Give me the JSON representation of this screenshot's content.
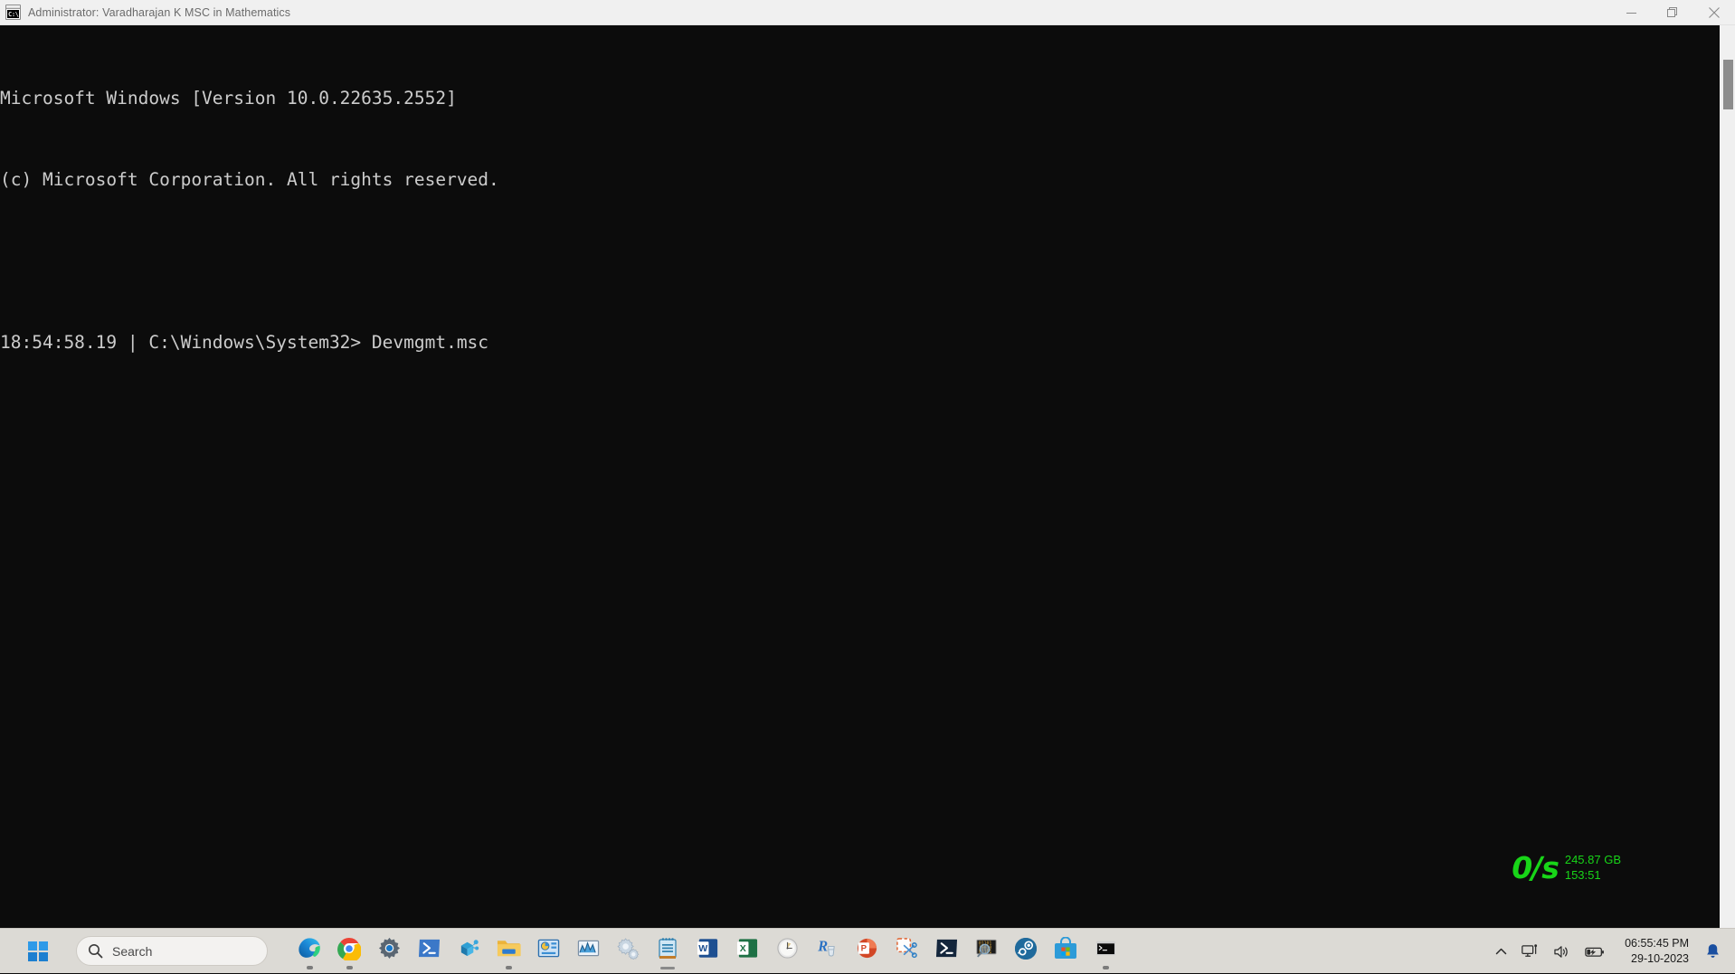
{
  "window": {
    "title": "Administrator:  Varadharajan K MSC in  Mathematics",
    "icon": "cmd-console-icon",
    "icon_glyph": "C:\\",
    "controls": {
      "minimize": "Minimize",
      "restore": "Restore Down",
      "close": "Close"
    }
  },
  "terminal": {
    "background_color": "#0c0c0c",
    "text_color": "#cccccc",
    "lines": [
      "Microsoft Windows [Version 10.0.22635.2552]",
      "(c) Microsoft Corporation. All rights reserved.",
      "",
      "18:54:58.19 | C:\\Windows\\System32> Devmgmt.msc"
    ]
  },
  "speed_widget": {
    "rate": "0/s",
    "size": "245.87 GB",
    "time": "153:51",
    "color": "#18d518"
  },
  "taskbar": {
    "start_label": "Start",
    "search": {
      "placeholder": "Search",
      "icon": "search-icon"
    },
    "apps": [
      {
        "name": "microsoft-edge",
        "label": "Microsoft Edge",
        "running": true
      },
      {
        "name": "google-chrome",
        "label": "Google Chrome",
        "running": true
      },
      {
        "name": "settings",
        "label": "Settings",
        "running": false
      },
      {
        "name": "windows-powershell",
        "label": "Windows PowerShell",
        "running": false
      },
      {
        "name": "network-app",
        "label": "Network Tool",
        "running": false
      },
      {
        "name": "file-explorer",
        "label": "File Explorer",
        "running": true
      },
      {
        "name": "resource-monitor",
        "label": "Resource Monitor",
        "running": false
      },
      {
        "name": "performance-monitor",
        "label": "Performance Monitor",
        "running": false
      },
      {
        "name": "system-configuration",
        "label": "System Configuration",
        "running": false
      },
      {
        "name": "notepad",
        "label": "Notepad",
        "running": true
      },
      {
        "name": "microsoft-word",
        "label": "Microsoft Word",
        "running": false
      },
      {
        "name": "microsoft-excel",
        "label": "Microsoft Excel",
        "running": false
      },
      {
        "name": "clock",
        "label": "Clock",
        "running": false
      },
      {
        "name": "r-statistics",
        "label": "R",
        "running": false
      },
      {
        "name": "microsoft-powerpoint",
        "label": "Microsoft PowerPoint",
        "running": false
      },
      {
        "name": "snipping-tool",
        "label": "Snipping Tool",
        "running": false
      },
      {
        "name": "powershell-7",
        "label": "PowerShell 7",
        "running": false
      },
      {
        "name": "code-inspector",
        "label": "Code Inspector",
        "running": false
      },
      {
        "name": "steam",
        "label": "Steam",
        "running": false
      },
      {
        "name": "microsoft-store",
        "label": "Microsoft Store",
        "running": false
      },
      {
        "name": "command-prompt",
        "label": "Command Prompt",
        "running": true
      }
    ],
    "tray": {
      "chevron": "Show hidden icons",
      "network": "Network",
      "volume": "Volume",
      "battery": "Battery charging",
      "time": "06:55:45 PM",
      "date": "29-10-2023",
      "notifications": "Notifications"
    }
  }
}
